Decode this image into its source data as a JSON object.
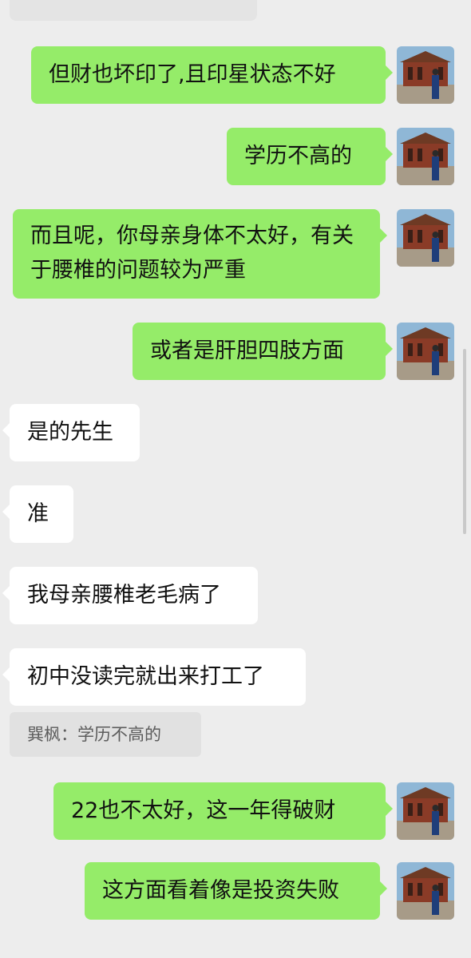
{
  "chat": {
    "messages": [
      {
        "side": "out",
        "text": "但财也坏印了,且印星状态不好"
      },
      {
        "side": "out",
        "text": "学历不高的"
      },
      {
        "side": "out",
        "text": "而且呢，你母亲身体不太好，有关于腰椎的问题较为严重"
      },
      {
        "side": "out",
        "text": "或者是肝胆四肢方面"
      },
      {
        "side": "in",
        "text": "是的先生"
      },
      {
        "side": "in",
        "text": "准"
      },
      {
        "side": "in",
        "text": "我母亲腰椎老毛病了"
      },
      {
        "side": "in",
        "text": "初中没读完就出来打工了"
      },
      {
        "side": "out",
        "text": "22也不太好，这一年得破财"
      },
      {
        "side": "out",
        "text": "这方面看着像是投资失败"
      }
    ],
    "quote": "巽枫：学历不高的"
  },
  "colors": {
    "background": "#ededed",
    "outgoing_bubble": "#95ec69",
    "incoming_bubble": "#ffffff",
    "quote_background": "#e1e1e1"
  },
  "icons": {
    "avatar": "avatar-temple-photo"
  }
}
